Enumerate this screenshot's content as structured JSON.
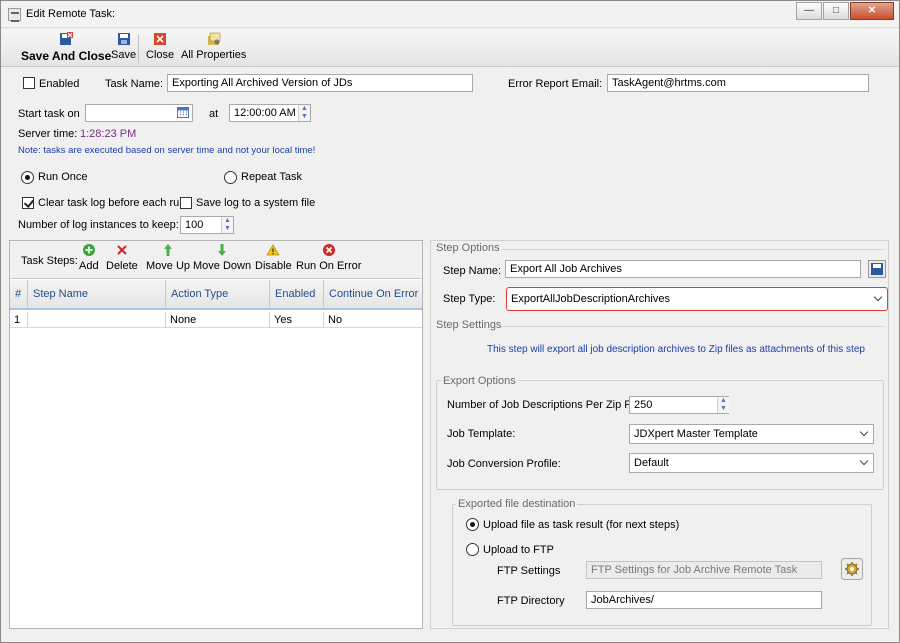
{
  "window": {
    "title": "Edit Remote Task:"
  },
  "toolbar": {
    "save_and_close": "Save And Close",
    "save": "Save",
    "close": "Close",
    "all_properties": "All Properties"
  },
  "task": {
    "enabled_label": "Enabled",
    "enabled": false,
    "name_label": "Task Name:",
    "name_value": "Exporting All Archived Version of JDs",
    "error_email_label": "Error Report Email:",
    "error_email_value": "TaskAgent@hrtms.com",
    "start_label": "Start task on",
    "start_date": "",
    "at_label": "at",
    "start_time": "12:00:00 AM",
    "server_time_label": "Server time:",
    "server_time_value": "1:28:23 PM",
    "note": "Note: tasks are executed based on server time and not your local time!",
    "run_once_label": "Run Once",
    "repeat_task_label": "Repeat Task",
    "clear_log_label": "Clear task log before each run",
    "save_log_label": "Save log to a system file",
    "log_instances_label": "Number of log instances to keep:",
    "log_instances_value": "100"
  },
  "steps_toolbar": {
    "label": "Task Steps:",
    "add": "Add",
    "delete": "Delete",
    "move_up": "Move Up",
    "move_down": "Move Down",
    "disable": "Disable",
    "run_on_error": "Run On Error"
  },
  "steps_grid": {
    "columns": [
      "#",
      "Step Name",
      "Action Type",
      "Enabled",
      "Continue On Error"
    ],
    "rows": [
      [
        "1",
        "",
        "None",
        "Yes",
        "No"
      ]
    ]
  },
  "step_options": {
    "title": "Step Options",
    "name_label": "Step Name:",
    "name_value": "Export All Job Archives",
    "type_label": "Step Type:",
    "type_value": "ExportAllJobDescriptionArchives"
  },
  "step_settings": {
    "title": "Step Settings",
    "description": "This step will export all job description archives to Zip files as attachments of this step",
    "export_options_title": "Export Options",
    "per_zip_label": "Number of Job Descriptions Per Zip File:",
    "per_zip_value": "250",
    "template_label": "Job Template:",
    "template_value": "JDXpert Master Template",
    "profile_label": "Job Conversion Profile:",
    "profile_value": "Default",
    "destination_title": "Exported file destination",
    "upload_result_label": "Upload file as task result (for next steps)",
    "upload_ftp_label": "Upload to FTP",
    "ftp_settings_label": "FTP Settings",
    "ftp_settings_value": "FTP Settings for Job Archive Remote Task",
    "ftp_directory_label": "FTP Directory",
    "ftp_directory_value": "JobArchives/"
  },
  "colors": {
    "accent_blue": "#1f4e8c",
    "server_time": "#7b2a8c",
    "note_blue": "#1b3fa8",
    "highlight_red": "#e23a3a"
  }
}
